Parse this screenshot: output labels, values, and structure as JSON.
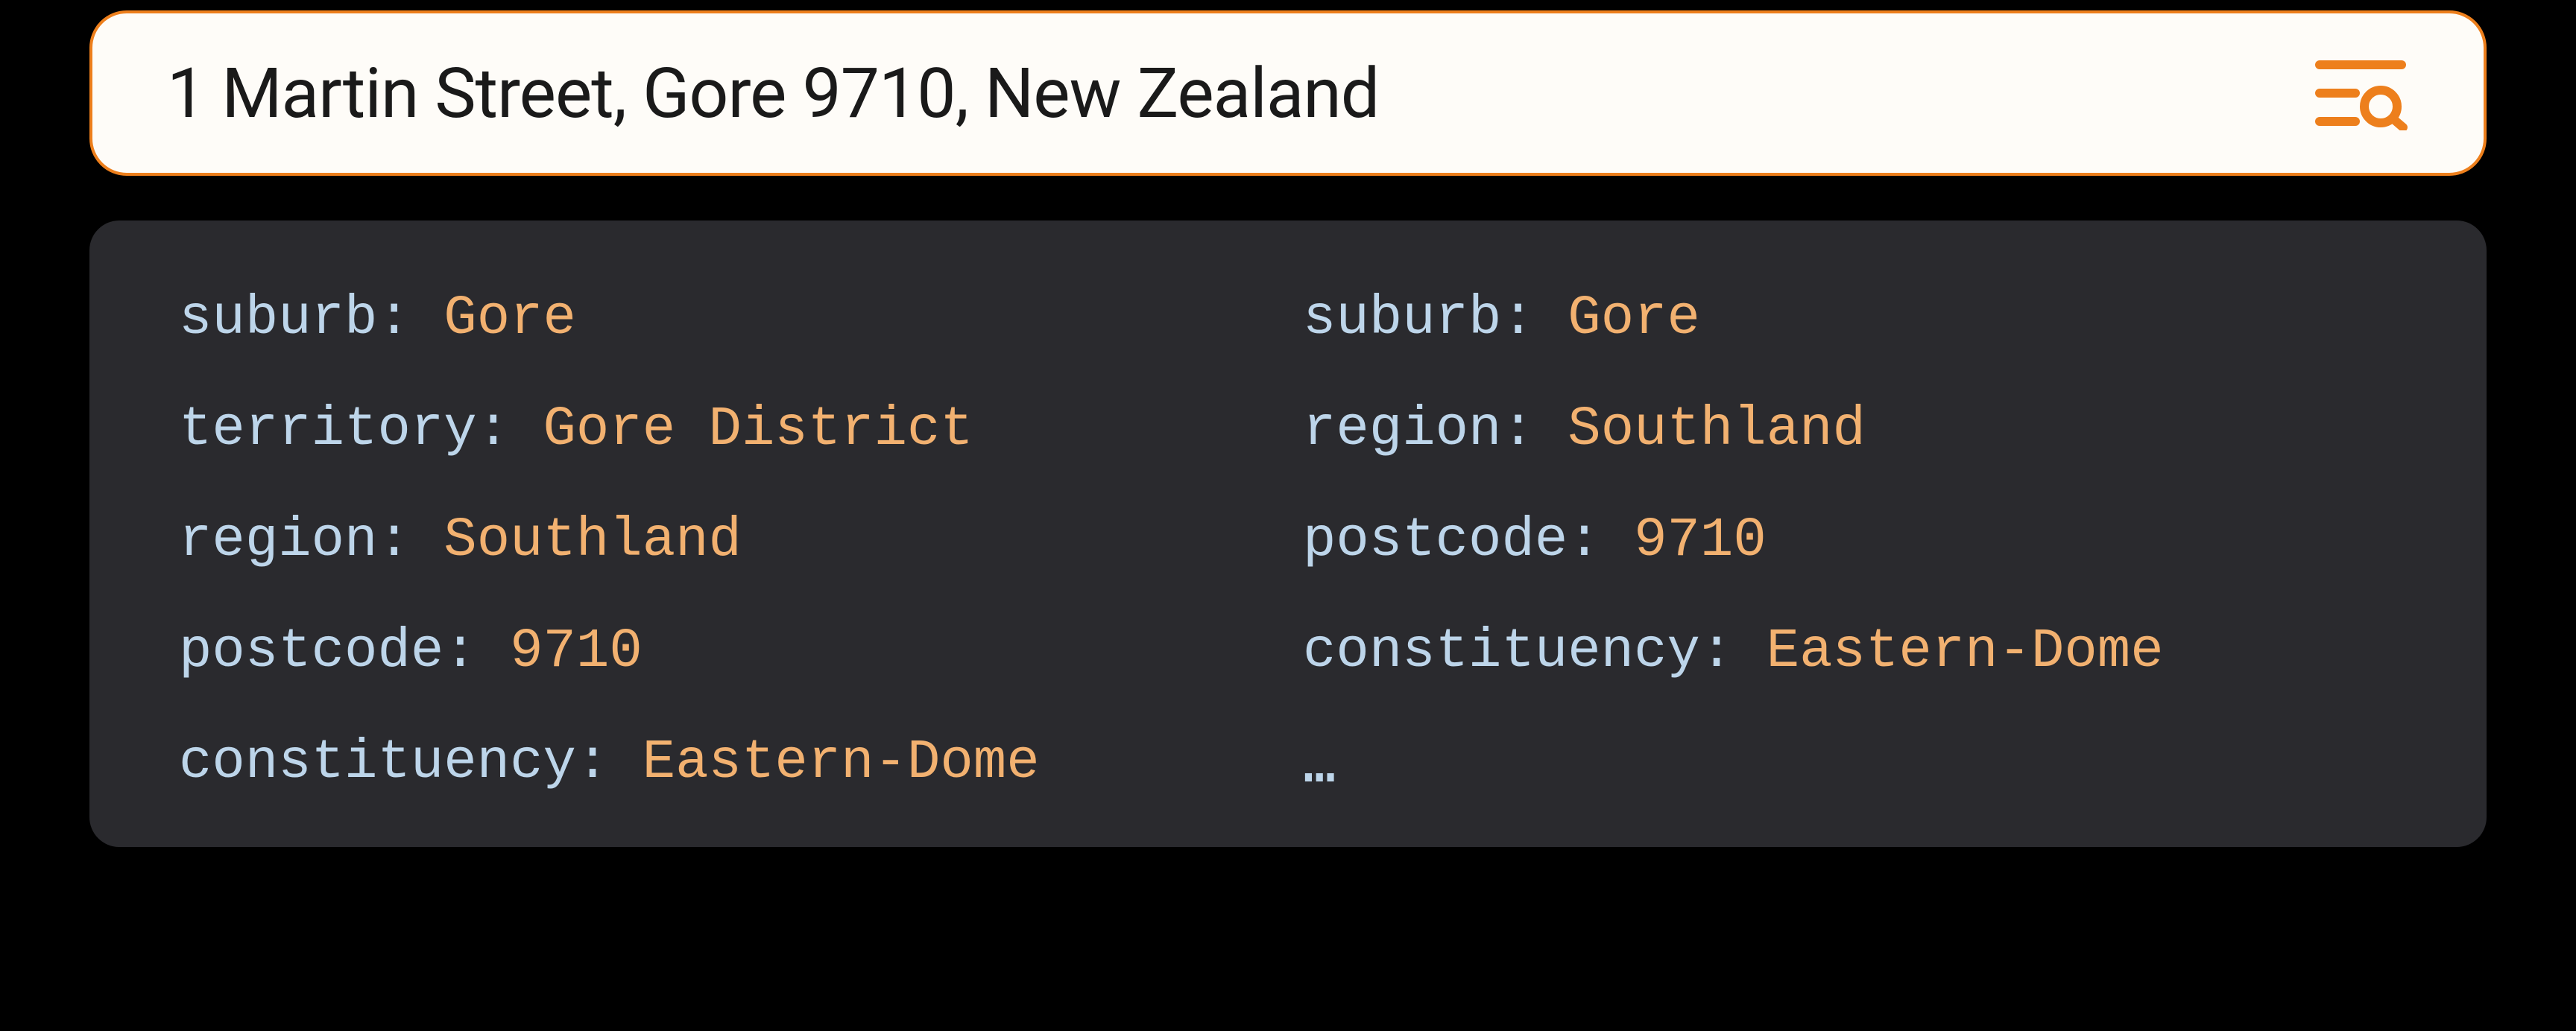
{
  "search": {
    "value": "1 Martin Street, Gore 9710, New Zealand"
  },
  "separator": ": ",
  "results": {
    "left": [
      {
        "key": "suburb",
        "value": "Gore"
      },
      {
        "key": "territory",
        "value": "Gore District"
      },
      {
        "key": "region",
        "value": "Southland"
      },
      {
        "key": "postcode",
        "value": "9710"
      },
      {
        "key": "constituency",
        "value": "Eastern-Dome"
      }
    ],
    "right": [
      {
        "key": "suburb",
        "value": "Gore"
      },
      {
        "key": "region",
        "value": "Southland"
      },
      {
        "key": "postcode",
        "value": "9710"
      },
      {
        "key": "constituency",
        "value": "Eastern-Dome"
      }
    ],
    "ellipsis": "…"
  },
  "colors": {
    "accent": "#ed7f1c",
    "panel": "#2a2a2e",
    "key": "#bdd5ea",
    "value": "#f2b170"
  }
}
